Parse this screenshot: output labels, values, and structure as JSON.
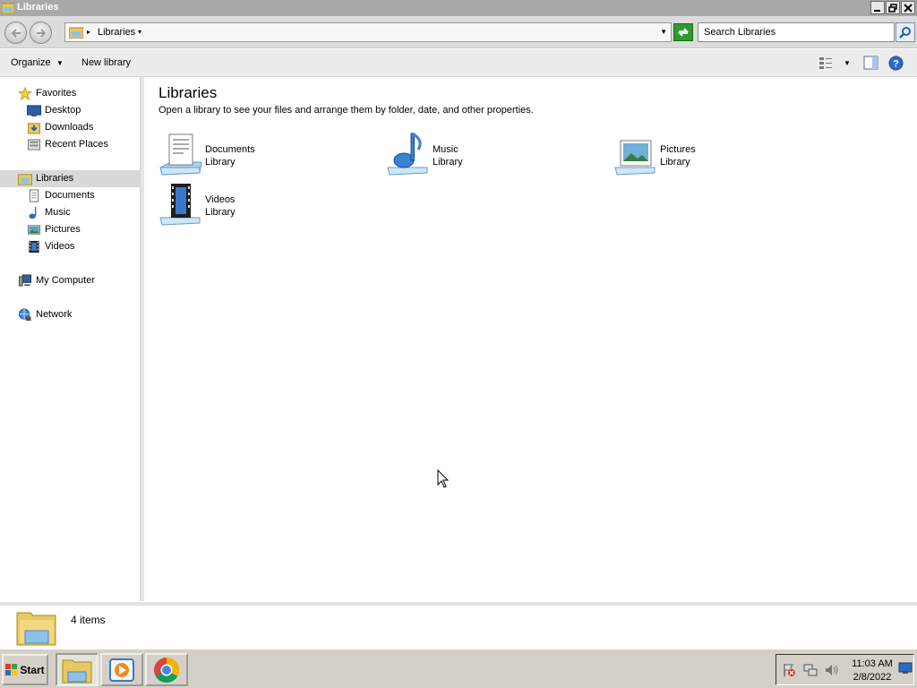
{
  "window": {
    "title": "Libraries"
  },
  "address_bar": {
    "crumb": "Libraries",
    "search_placeholder": "Search Libraries"
  },
  "command_bar": {
    "organize": "Organize",
    "new_library": "New library"
  },
  "nav_pane": {
    "favorites": {
      "label": "Favorites",
      "items": [
        "Desktop",
        "Downloads",
        "Recent Places"
      ]
    },
    "libraries": {
      "label": "Libraries",
      "items": [
        "Documents",
        "Music",
        "Pictures",
        "Videos"
      ]
    },
    "computer": "My Computer",
    "network": "Network"
  },
  "content": {
    "heading": "Libraries",
    "description": "Open a library to see your files and arrange them by folder, date, and other properties.",
    "libraries": [
      {
        "name": "Documents",
        "type": "Library",
        "icon": "documents-library-icon"
      },
      {
        "name": "Music",
        "type": "Library",
        "icon": "music-library-icon"
      },
      {
        "name": "Pictures",
        "type": "Library",
        "icon": "pictures-library-icon"
      },
      {
        "name": "Videos",
        "type": "Library",
        "icon": "videos-library-icon"
      }
    ]
  },
  "details_pane": {
    "item_count": "4 items"
  },
  "taskbar": {
    "start_label": "Start",
    "time": "11:03 AM",
    "date": "2/8/2022"
  },
  "colors": {
    "titlebar": "#a9a9a9",
    "selection": "#d8d8d8",
    "taskbar": "#d4d0c8",
    "refresh_green": "#2f9a2f"
  }
}
